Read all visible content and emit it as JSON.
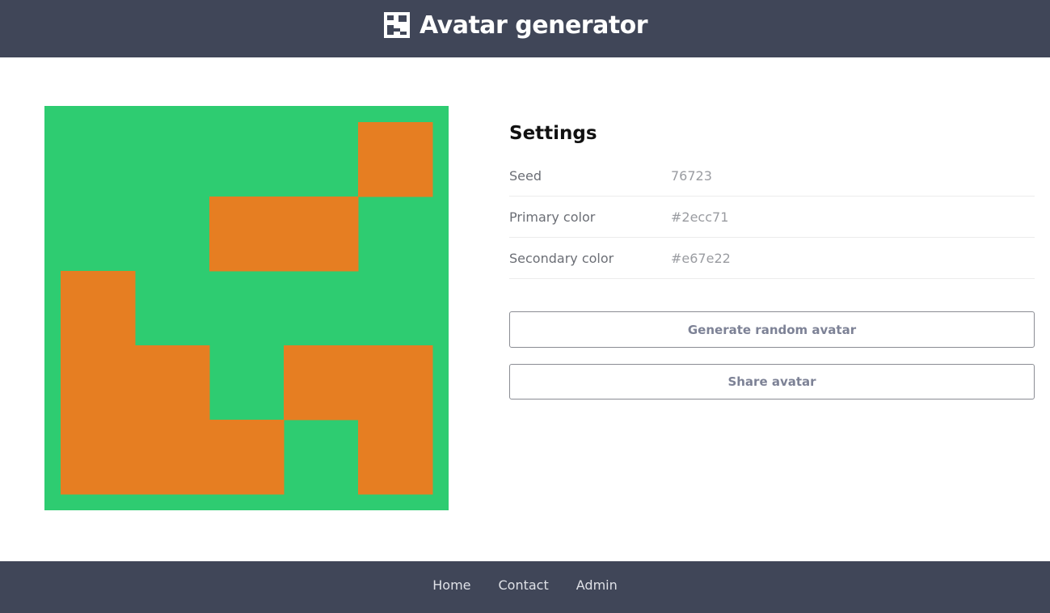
{
  "header": {
    "title": "Avatar generator",
    "logo_icon": "identicon-logo-icon"
  },
  "avatar": {
    "primary_color": "#2ecc71",
    "secondary_color": "#e67e22",
    "grid": [
      [
        0,
        0,
        0,
        0,
        1
      ],
      [
        0,
        0,
        1,
        1,
        0
      ],
      [
        1,
        0,
        0,
        0,
        0
      ],
      [
        1,
        1,
        0,
        1,
        1
      ],
      [
        1,
        1,
        1,
        0,
        1
      ]
    ]
  },
  "settings": {
    "heading": "Settings",
    "rows": [
      {
        "label": "Seed",
        "value": "76723"
      },
      {
        "label": "Primary color",
        "value": "#2ecc71"
      },
      {
        "label": "Secondary color",
        "value": "#e67e22"
      }
    ],
    "generate_label": "Generate random avatar",
    "share_label": "Share avatar"
  },
  "footer": {
    "links": [
      {
        "label": "Home"
      },
      {
        "label": "Contact"
      },
      {
        "label": "Admin"
      }
    ]
  },
  "colors": {
    "bar_background": "#404658",
    "button_text": "#7d8296"
  }
}
